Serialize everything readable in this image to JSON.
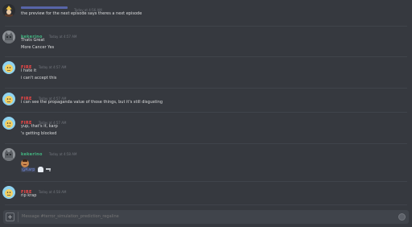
{
  "colors": {
    "background": "#36393f",
    "fire": "#f04747",
    "kekerino": "#43b581",
    "top_user": "#7289da"
  },
  "messages": [
    {
      "author": "",
      "timestamp": "Today at 4:56 AM",
      "avatar_icon": "blonde-character-avatar",
      "lines": [
        "the preview for the next episode says theres a next episode"
      ]
    },
    {
      "author": "kekerino",
      "timestamp": "Today at 4:57 AM",
      "avatar_icon": "gray-cat-avatar",
      "lines": [
        "Thats Great",
        "More Cancer Yes"
      ]
    },
    {
      "author": "FIRE",
      "timestamp": "Today at 4:57 AM",
      "avatar_icon": "blue-fire-avatar",
      "lines": [
        "i hate it",
        "i can't accept this"
      ]
    },
    {
      "author": "FIRE",
      "timestamp": "Today at 4:57 AM",
      "avatar_icon": "blue-fire-avatar",
      "lines": [
        "i can see the propaganda value of those things, but it's still disgusting"
      ]
    },
    {
      "author": "FIRE",
      "timestamp": "Today at 4:57 AM",
      "avatar_icon": "blue-fire-avatar",
      "lines": [
        "yup, that's it, karp",
        "'s getting blocked"
      ]
    },
    {
      "author": "kekerino",
      "timestamp": "Today at 4:58 AM",
      "avatar_icon": "gray-cat-avatar",
      "emoji_line": "face-emoji",
      "mention": "@Karp",
      "mention_emojis": [
        "ghost-emoji",
        "gun-emoji"
      ]
    },
    {
      "author": "FIRE",
      "timestamp": "Today at 4:58 AM",
      "avatar_icon": "blue-fire-avatar",
      "lines": [
        "rip krap"
      ]
    }
  ],
  "composer": {
    "placeholder": "Message #terror_simulation_prediction_regaline",
    "upload_icon": "plus",
    "emoji_icon": "emoji-picker-icon"
  }
}
